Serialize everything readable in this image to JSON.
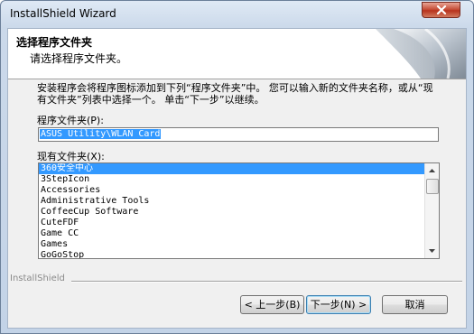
{
  "window": {
    "title": "InstallShield Wizard"
  },
  "header": {
    "title": "选择程序文件夹",
    "subtitle": "请选择程序文件夹。"
  },
  "body": {
    "description": "安装程序会将程序图标添加到下列“程序文件夹”中。 您可以输入新的文件夹名称，或从“现有文件夹”列表中选择一个。 单击“下一步”以继续。",
    "program_folder_label": "程序文件夹(P):",
    "program_folder_value": "ASUS Utility\\WLAN Card",
    "existing_folders_label": "现有文件夹(X):",
    "existing_folders": [
      "360安全中心",
      "3StepIcon",
      "Accessories",
      "Administrative Tools",
      "CoffeeCup Software",
      "CuteFDF",
      "Game CC",
      "Games",
      "GoGoStop"
    ],
    "selected_index": 0
  },
  "footer": {
    "brand": "InstallShield",
    "back_label": "< 上一步(B)",
    "next_label": "下一步(N) >",
    "cancel_label": "取消"
  },
  "colors": {
    "selection": "#3399ff",
    "close_button": "#c7503a"
  }
}
